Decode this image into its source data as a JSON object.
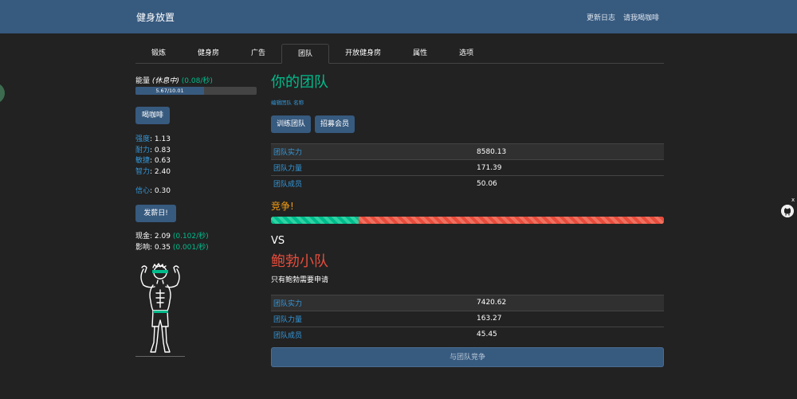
{
  "navbar": {
    "brand": "健身放置",
    "links": [
      "更新日志",
      "请我喝咖啡"
    ]
  },
  "tabs": [
    "锻炼",
    "健身房",
    "广告",
    "团队",
    "开放健身房",
    "属性",
    "选项"
  ],
  "active_tab": "团队",
  "sidebar": {
    "energy_label": "能量",
    "energy_state": "(休息中)",
    "energy_rate": "(0.08/秒)",
    "energy_progress_text": "5.67/10.01",
    "energy_fraction": 0.566,
    "coffee_button": "喝咖啡",
    "stats": [
      {
        "label": "强度",
        "value": "1.13"
      },
      {
        "label": "耐力",
        "value": "0.83"
      },
      {
        "label": "敏捷",
        "value": "0.63"
      },
      {
        "label": "智力",
        "value": "2.40"
      }
    ],
    "confidence_label": "信心",
    "confidence_value": "0.30",
    "payday_button": "发薪日!",
    "money_label": "现金",
    "money_value": "2.09",
    "money_rate": "(0.102/秒)",
    "influence_label": "影响",
    "influence_value": "0.35",
    "influence_rate": "(0.001/秒)"
  },
  "team": {
    "title": "你的团队",
    "edit_link": "编辑团队 名称",
    "train_button": "训练团队",
    "recruit_button": "招募会员",
    "rows": [
      {
        "label": "团队实力",
        "value": "8580.13"
      },
      {
        "label": "团队力量",
        "value": "171.39"
      },
      {
        "label": "团队成员",
        "value": "50.06"
      }
    ]
  },
  "competition": {
    "title": "竞争!",
    "my_share": 0.223,
    "vs": "VS",
    "button": "与团队竞争"
  },
  "enemy": {
    "title": "鲍勃小队",
    "description": "只有鲍勃需要申请",
    "rows": [
      {
        "label": "团队实力",
        "value": "7420.62"
      },
      {
        "label": "团队力量",
        "value": "163.27"
      },
      {
        "label": "团队成员",
        "value": "45.45"
      }
    ]
  },
  "colors": {
    "navbar": "#375a7f",
    "background": "#222222",
    "success": "#00bc8c",
    "danger": "#e74c3c",
    "warning": "#f39c12",
    "link": "#3498db"
  },
  "icons": {
    "athlete": "athlete-figure-icon",
    "github": "github-icon"
  }
}
